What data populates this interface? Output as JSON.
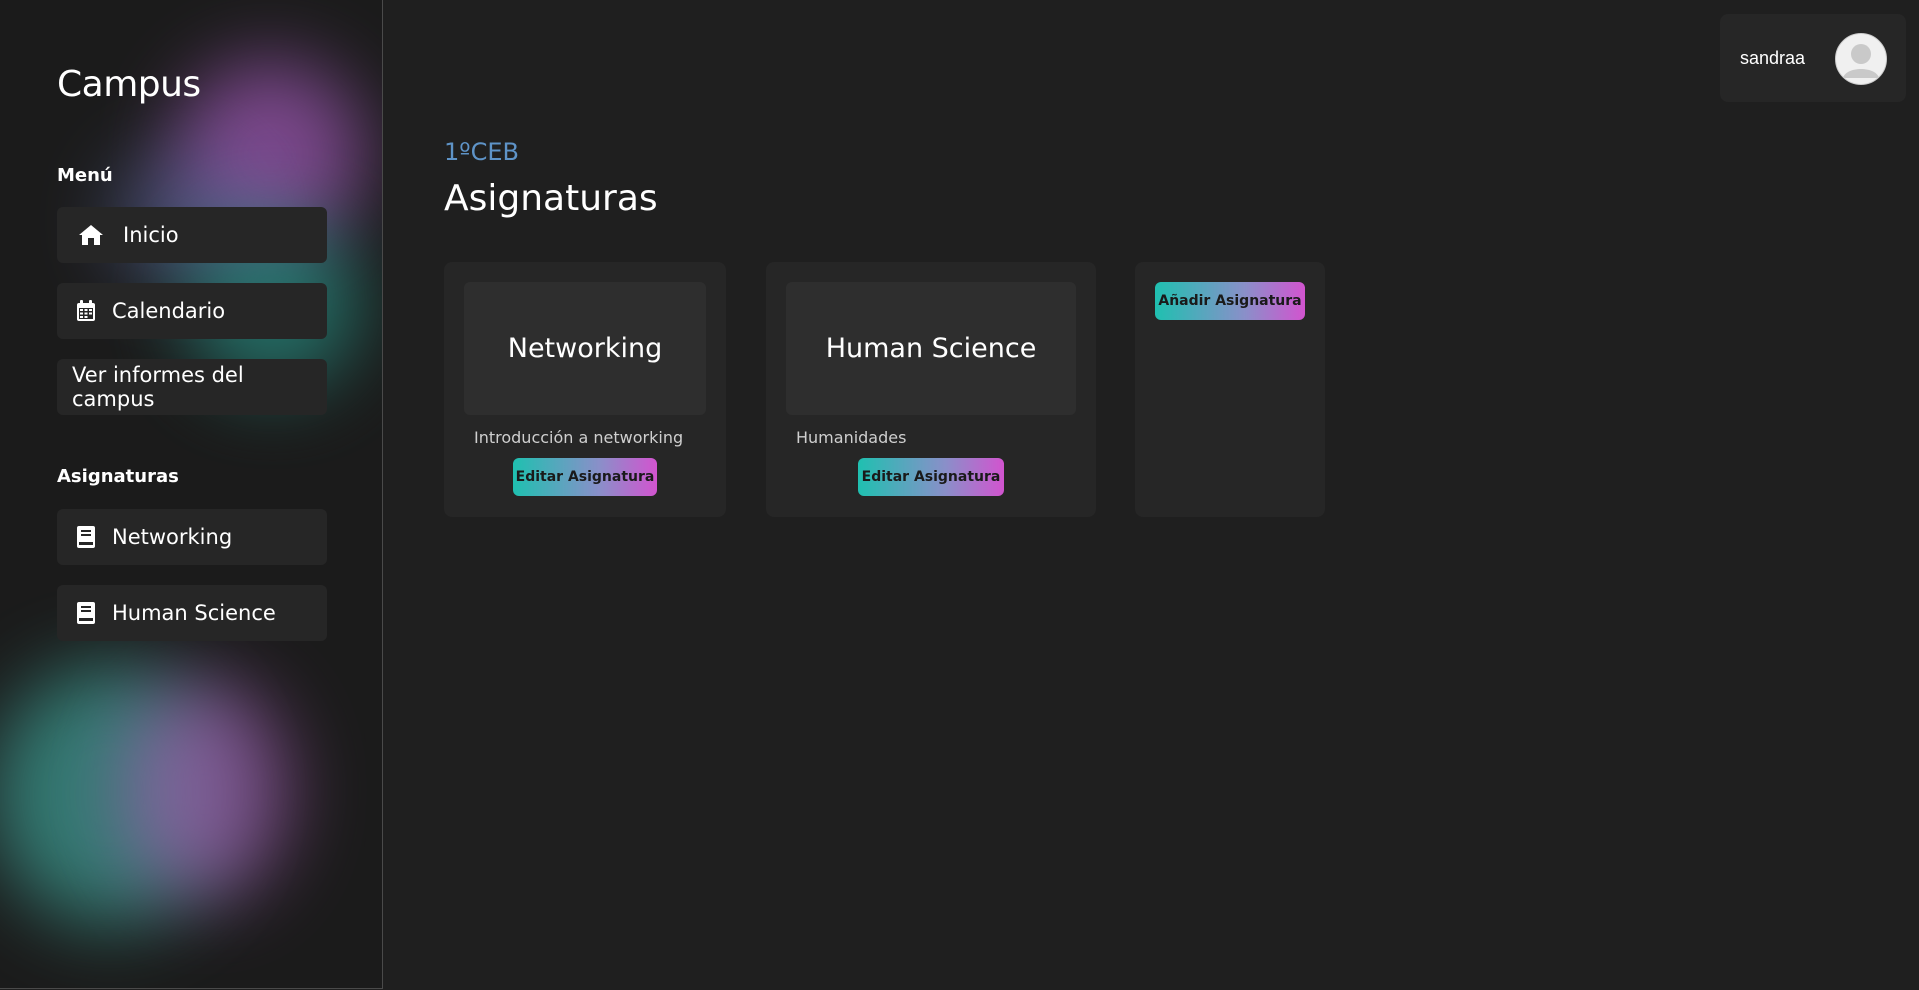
{
  "sidebar": {
    "brand": "Campus",
    "menu_label": "Menú",
    "menu_items": [
      {
        "label": "Inicio",
        "icon": "home-icon"
      },
      {
        "label": "Calendario",
        "icon": "calendar-icon"
      },
      {
        "label": "Ver informes del campus",
        "icon": ""
      }
    ],
    "subjects_label": "Asignaturas",
    "subject_items": [
      {
        "label": "Networking",
        "icon": "book-icon"
      },
      {
        "label": "Human Science",
        "icon": "book-icon"
      }
    ]
  },
  "header": {
    "username": "sandraa",
    "avatar_icon": "user-avatar-icon"
  },
  "main": {
    "subtitle": "1ºCEB",
    "title": "Asignaturas",
    "cards": [
      {
        "title": "Networking",
        "description": "Introducción a networking",
        "edit_label": "Editar Asignatura"
      },
      {
        "title": "Human Science",
        "description": "Humanidades",
        "edit_label": "Editar Asignatura"
      }
    ],
    "add_label": "Añadir Asignatura"
  },
  "colors": {
    "background": "#1f1f1f",
    "panel": "#262626",
    "accent_blue": "#5e93c7",
    "gradient_start": "#1fc0b0",
    "gradient_end": "#d254cf"
  }
}
